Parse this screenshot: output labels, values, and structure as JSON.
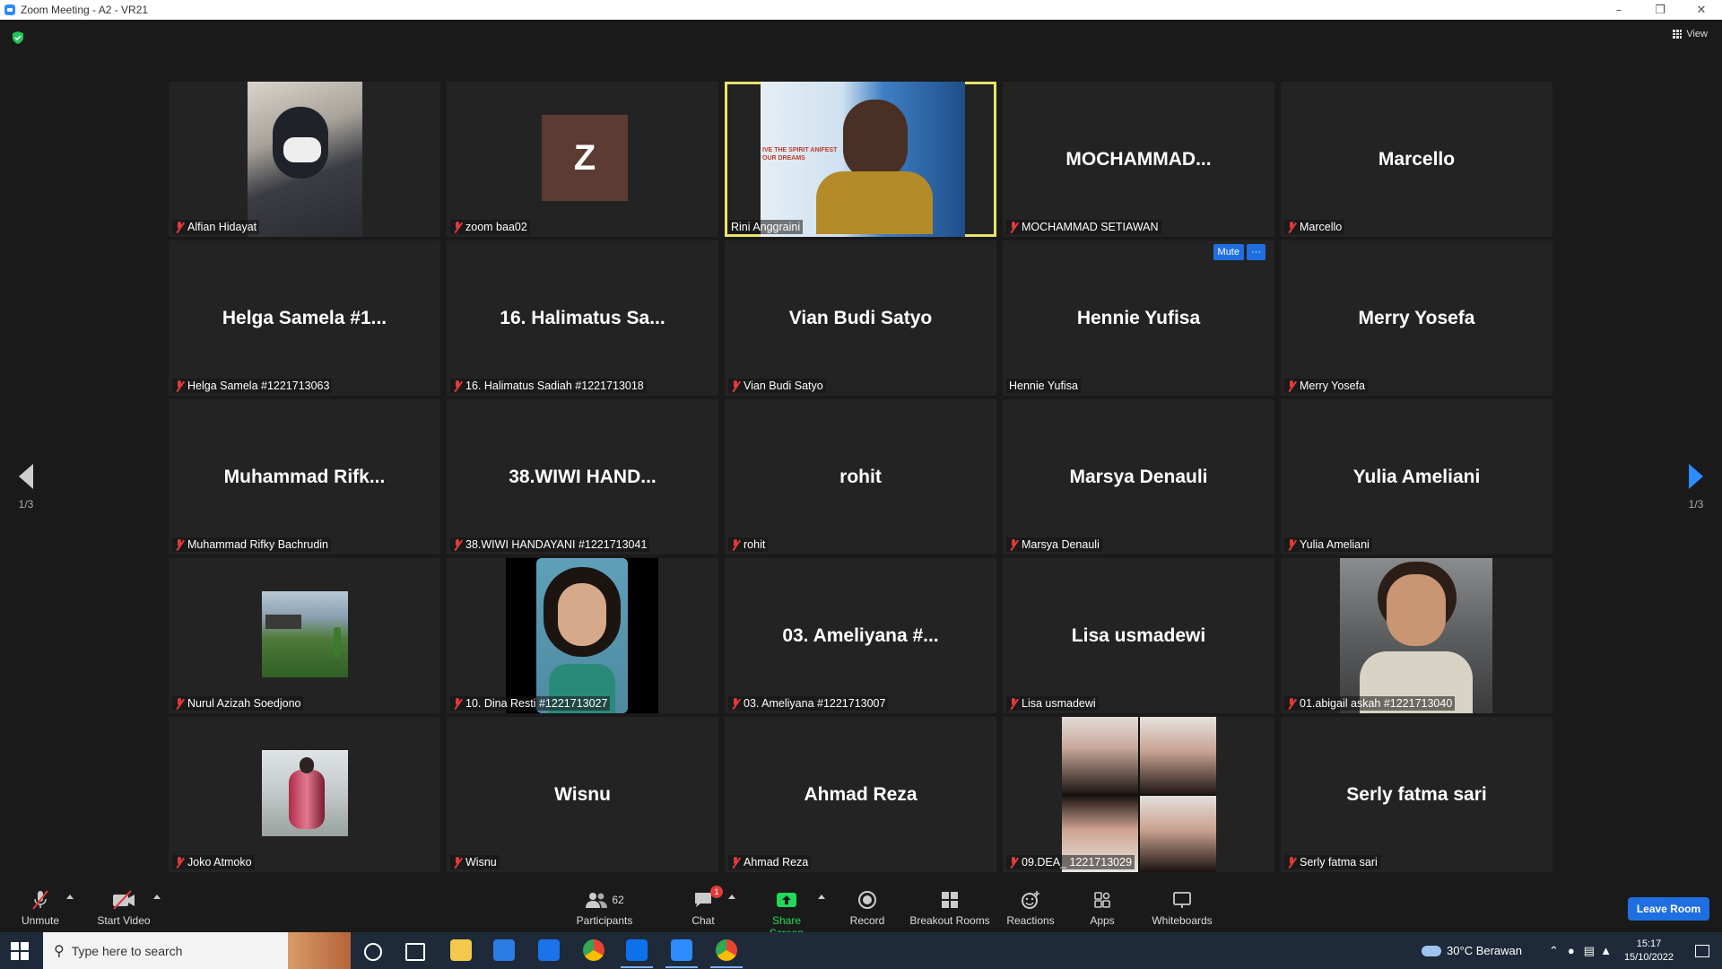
{
  "window": {
    "title": "Zoom Meeting - A2 - VR21"
  },
  "meeting": {
    "view_label": "View",
    "page_indicator_left": "1/3",
    "page_indicator_right": "1/3",
    "tile_controls": {
      "mute": "Mute",
      "more": "···"
    },
    "tiles": [
      {
        "display": "",
        "label": "Alfian Hidayat",
        "muted": true,
        "video": true
      },
      {
        "display": "Z",
        "label": "zoom baa02",
        "muted": true,
        "avatar": true
      },
      {
        "display": "",
        "label": "Rini Anggraini",
        "muted": false,
        "video": true,
        "active": true,
        "banner": "IVE THE SPIRIT ANIFEST OUR DREAMS"
      },
      {
        "display": "MOCHAMMAD...",
        "label": "MOCHAMMAD SETIAWAN",
        "muted": true
      },
      {
        "display": "Marcello",
        "label": "Marcello",
        "muted": true
      },
      {
        "display": "Helga Samela #1...",
        "label": "Helga Samela #1221713063",
        "muted": true
      },
      {
        "display": "16. Halimatus Sa...",
        "label": "16. Halimatus Sadiah #1221713018",
        "muted": true
      },
      {
        "display": "Vian Budi Satyo",
        "label": "Vian Budi Satyo",
        "muted": true
      },
      {
        "display": "Hennie Yufisa",
        "label": "Hennie Yufisa",
        "muted": false,
        "hover": true
      },
      {
        "display": "Merry Yosefa",
        "label": "Merry Yosefa",
        "muted": true
      },
      {
        "display": "Muhammad  Rifk...",
        "label": "Muhammad Rifky Bachrudin",
        "muted": true
      },
      {
        "display": "38.WIWI  HAND...",
        "label": "38.WIWI HANDAYANI #1221713041",
        "muted": true
      },
      {
        "display": "rohit",
        "label": "rohit",
        "muted": true
      },
      {
        "display": "Marsya Denauli",
        "label": "Marsya Denauli",
        "muted": true
      },
      {
        "display": "Yulia Ameliani",
        "label": "Yulia Ameliani",
        "muted": true
      },
      {
        "display": "",
        "label": "Nurul Azizah Soedjono",
        "muted": true,
        "photo": "landscape"
      },
      {
        "display": "",
        "label": "10. Dina Resti #1221713027",
        "muted": true,
        "video": true
      },
      {
        "display": "03. Ameliyana #...",
        "label": "03. Ameliyana #1221713007",
        "muted": true
      },
      {
        "display": "Lisa usmadewi",
        "label": "Lisa usmadewi",
        "muted": true
      },
      {
        "display": "",
        "label": "01.abigail askah #1221713040",
        "muted": true,
        "video": true
      },
      {
        "display": "",
        "label": "Joko Atmoko",
        "muted": true,
        "photo": "portrait"
      },
      {
        "display": "Wisnu",
        "label": "Wisnu",
        "muted": true
      },
      {
        "display": "Ahmad Reza",
        "label": "Ahmad Reza",
        "muted": true
      },
      {
        "display": "",
        "label": "09.DEA_ 1221713029",
        "muted": true,
        "photo": "collage"
      },
      {
        "display": "Serly fatma sari",
        "label": "Serly fatma sari",
        "muted": true
      }
    ]
  },
  "toolbar": {
    "unmute": "Unmute",
    "start_video": "Start Video",
    "participants": "Participants",
    "participants_count": "62",
    "chat": "Chat",
    "chat_badge": "1",
    "share_screen": "Share Screen",
    "record": "Record",
    "breakout_rooms": "Breakout Rooms",
    "reactions": "Reactions",
    "apps": "Apps",
    "whiteboards": "Whiteboards",
    "leave": "Leave Room"
  },
  "taskbar": {
    "search_placeholder": "Type here to search",
    "weather": "30°C  Berawan",
    "time": "15:17",
    "date": "15/10/2022"
  },
  "colors": {
    "accent": "#2d8cff",
    "active_speaker": "#e9e46a",
    "share_green": "#23d959",
    "mute_red": "#e03a3a",
    "tile_bg": "#232323"
  }
}
